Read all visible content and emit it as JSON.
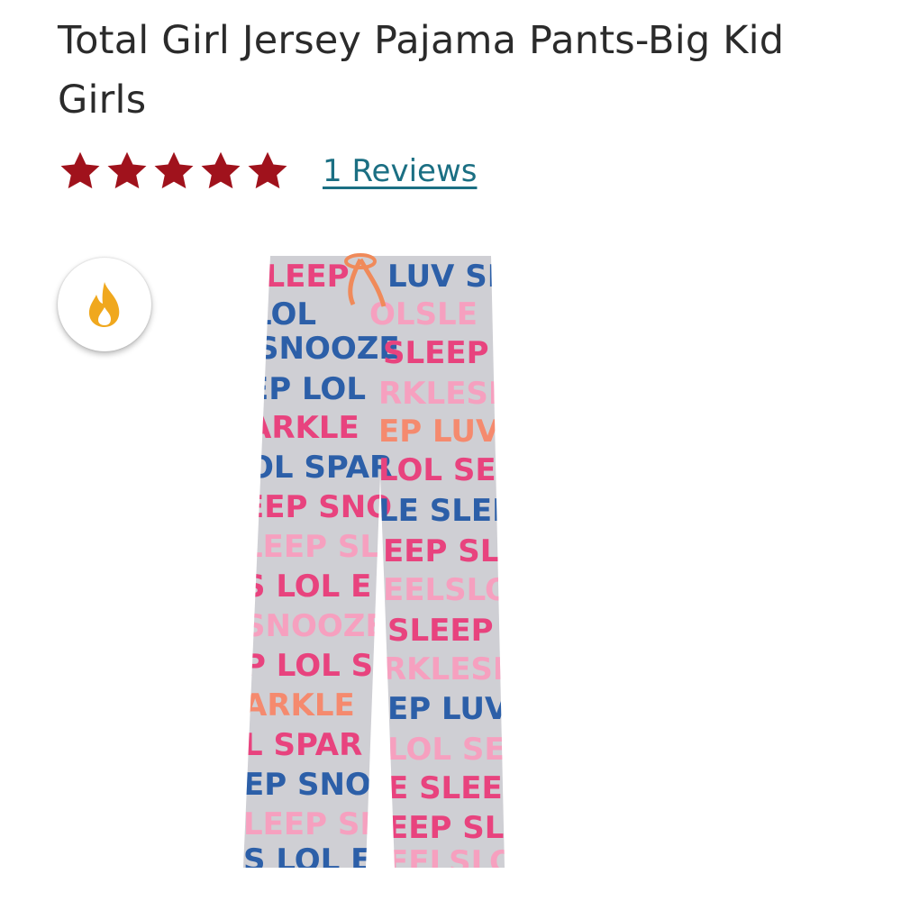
{
  "product": {
    "title": "Total Girl Jersey Pajama Pants-Big Kid Girls",
    "rating": 5,
    "rating_max": 5,
    "reviews_label": "1 Reviews",
    "star_color": "#a0121c",
    "link_color": "#1b6f83"
  },
  "badge": {
    "icon": "flame-icon",
    "color": "#f0a81e"
  },
  "image": {
    "description_icon": "pajama-pants-image",
    "pattern_words": [
      "SLEEP",
      "LOL",
      "SNOOZE",
      "SPARKLE",
      "LUV"
    ]
  }
}
